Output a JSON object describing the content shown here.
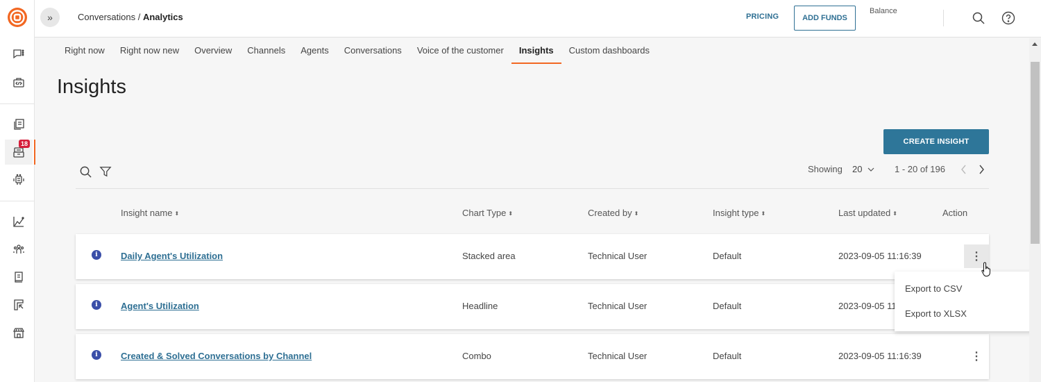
{
  "app": {
    "breadcrumb_parent": "Conversations",
    "breadcrumb_separator": " / ",
    "breadcrumb_current": "Analytics"
  },
  "rail": {
    "items": [
      {
        "icon": "chat-icon"
      },
      {
        "icon": "code-briefcase-icon"
      },
      {
        "icon": "documents-icon"
      },
      {
        "icon": "inbox-icon",
        "badge": "18",
        "active": true
      },
      {
        "icon": "robot-icon"
      },
      {
        "icon": "analytics-chart-icon"
      },
      {
        "icon": "people-icon"
      },
      {
        "icon": "book-icon"
      },
      {
        "icon": "layout-cursor-icon"
      },
      {
        "icon": "store-icon"
      }
    ]
  },
  "topbar": {
    "pricing_label": "PRICING",
    "add_funds_label": "ADD FUNDS",
    "balance_label": "Balance"
  },
  "tabs": [
    {
      "label": "Right now"
    },
    {
      "label": "Right now new"
    },
    {
      "label": "Overview"
    },
    {
      "label": "Channels"
    },
    {
      "label": "Agents"
    },
    {
      "label": "Conversations"
    },
    {
      "label": "Voice of the customer"
    },
    {
      "label": "Insights",
      "active": true
    },
    {
      "label": "Custom dashboards"
    }
  ],
  "page": {
    "title": "Insights",
    "create_button": "CREATE INSIGHT"
  },
  "pagination": {
    "showing_label": "Showing",
    "page_size": "20",
    "range": "1 - 20 of 196"
  },
  "table": {
    "columns": {
      "name": "Insight name",
      "chart_type": "Chart Type",
      "created_by": "Created by",
      "insight_type": "Insight type",
      "last_updated": "Last updated",
      "action": "Action"
    },
    "sort_glyph": "⬍",
    "rows": [
      {
        "name": "Daily Agent's Utilization",
        "chart_type": "Stacked area",
        "created_by": "Technical User",
        "insight_type": "Default",
        "last_updated": "2023-09-05 11:16:39"
      },
      {
        "name": "Agent's Utilization",
        "chart_type": "Headline",
        "created_by": "Technical User",
        "insight_type": "Default",
        "last_updated": "2023-09-05 11:16:39"
      },
      {
        "name": "Created & Solved Conversations by Channel",
        "chart_type": "Combo",
        "created_by": "Technical User",
        "insight_type": "Default",
        "last_updated": "2023-09-05 11:16:39"
      }
    ]
  },
  "action_menu": {
    "items": [
      "Export to CSV",
      "Export to XLSX"
    ]
  },
  "colors": {
    "brand_orange": "#f26722",
    "primary_blue": "#2e7699",
    "link_blue": "#2e6f93",
    "badge_red": "#d51e3b",
    "info_icon": "#3a4ea8"
  }
}
